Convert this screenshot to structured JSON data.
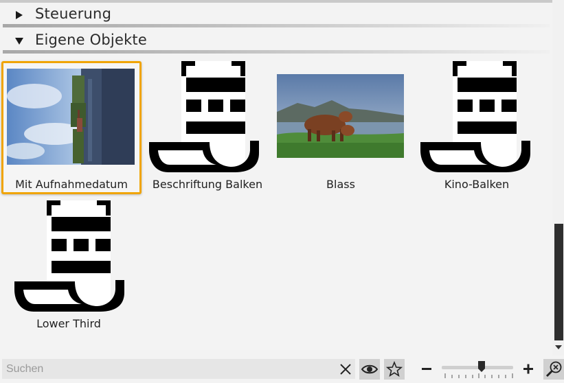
{
  "sections": [
    {
      "title": "Steuerung",
      "expanded": false
    },
    {
      "title": "Eigene Objekte",
      "expanded": true
    }
  ],
  "items": [
    {
      "label": "Mit Aufnahmedatum",
      "icon": "photo-thumbnail",
      "selected": true
    },
    {
      "label": "Beschriftung Balken",
      "icon": "text-object-icon",
      "selected": false
    },
    {
      "label": "Blass",
      "icon": "photo-thumbnail",
      "selected": false
    },
    {
      "label": "Kino-Balken",
      "icon": "text-object-icon",
      "selected": false
    },
    {
      "label": "Lower Third",
      "icon": "text-object-icon",
      "selected": false
    }
  ],
  "toolbar": {
    "search_placeholder": "Suchen",
    "search_value": "",
    "icons": [
      "clear-icon",
      "eye-icon",
      "star-icon",
      "zoom-out-icon",
      "zoom-in-icon",
      "zoom-reset-icon"
    ],
    "zoom_level": 0.55
  },
  "colors": {
    "selection": "#f0a400",
    "background": "#f3f3f3",
    "scrollbar_thumb": "#2e2e2e"
  }
}
